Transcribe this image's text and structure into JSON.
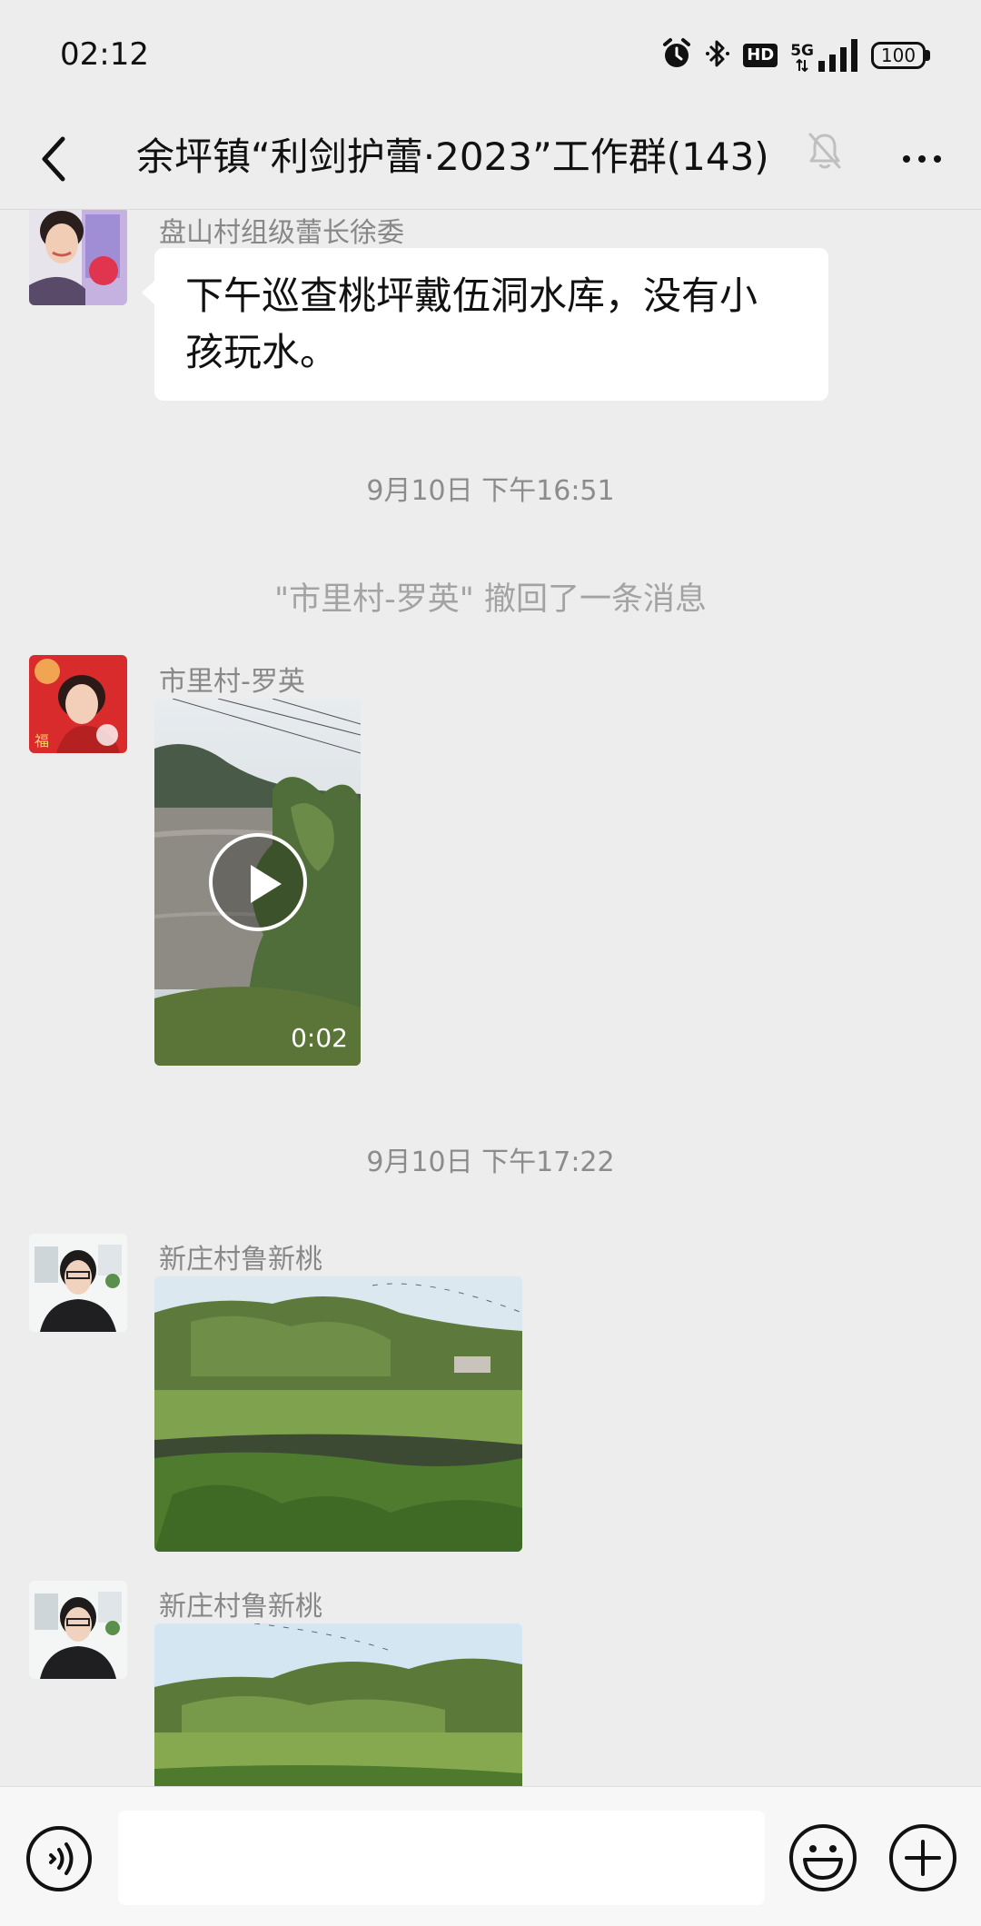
{
  "status_bar": {
    "time": "02:12",
    "network": "5G",
    "hd_label": "HD",
    "battery": "100",
    "icons": [
      "alarm-icon",
      "bluetooth-icon",
      "hd-icon",
      "signal-icon",
      "battery-icon"
    ]
  },
  "header": {
    "title": "余坪镇“利剑护蕾·2023”工作群(143)",
    "icons": [
      "back-arrow-icon",
      "mute-bell-icon",
      "more-icon"
    ]
  },
  "messages": [
    {
      "type": "text",
      "sender": "盘山村组级蕾长徐委",
      "text_line1": "下午巡查桃坪戴伍洞水库，没有小",
      "text_line2": "孩玩水。"
    },
    {
      "type": "time",
      "text": "9月10日 下午16:51"
    },
    {
      "type": "system",
      "text": "\"市里村-罗英\" 撤回了一条消息"
    },
    {
      "type": "video",
      "sender": "市里村-罗英",
      "duration": "0:02"
    },
    {
      "type": "time",
      "text": "9月10日 下午17:22"
    },
    {
      "type": "image",
      "sender": "新庄村鲁新桃"
    },
    {
      "type": "image",
      "sender": "新庄村鲁新桃"
    }
  ],
  "input_bar": {
    "value": "",
    "icons": [
      "voice-icon",
      "emoji-icon",
      "plus-icon"
    ]
  },
  "colors": {
    "background": "#ededed",
    "bubble": "#ffffff",
    "meta_text": "#8c8c8c"
  }
}
